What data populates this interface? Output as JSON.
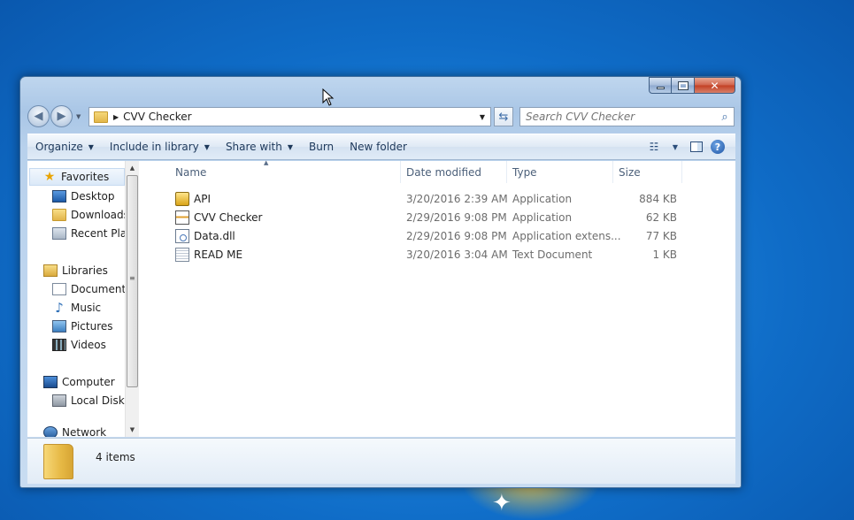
{
  "window": {
    "title": "CVV Checker",
    "controls": {
      "minimize": "minimize",
      "maximize": "maximize",
      "close": "✕"
    }
  },
  "navbar": {
    "address_path": "CVV Checker",
    "search_placeholder": "Search CVV Checker"
  },
  "toolbar": {
    "organize": "Organize",
    "include_in_library": "Include in library",
    "share_with": "Share with",
    "burn": "Burn",
    "new_folder": "New folder"
  },
  "navpane": {
    "favorites": "Favorites",
    "desktop": "Desktop",
    "downloads": "Downloads",
    "recent_places": "Recent Plac",
    "libraries": "Libraries",
    "documents": "Documents",
    "music": "Music",
    "pictures": "Pictures",
    "videos": "Videos",
    "computer": "Computer",
    "local_disk": "Local Disk (",
    "network": "Network"
  },
  "columns": {
    "name": "Name",
    "date_modified": "Date modified",
    "type": "Type",
    "size": "Size"
  },
  "files": [
    {
      "name": "API",
      "date": "3/20/2016 2:39 AM",
      "type": "Application",
      "size": "884 KB",
      "icon": "api-icon"
    },
    {
      "name": "CVV Checker",
      "date": "2/29/2016 9:08 PM",
      "type": "Application",
      "size": "62 KB",
      "icon": "application-icon"
    },
    {
      "name": "Data.dll",
      "date": "2/29/2016 9:08 PM",
      "type": "Application extens...",
      "size": "77 KB",
      "icon": "dll-icon"
    },
    {
      "name": "READ ME",
      "date": "3/20/2016 3:04 AM",
      "type": "Text Document",
      "size": "1 KB",
      "icon": "text-document-icon"
    }
  ],
  "details": {
    "item_count": "4 items"
  },
  "colors": {
    "desktop_blue": "#1a7fd8",
    "window_frame": "#b8d1ec",
    "close_red": "#c23f22",
    "toolbar_text": "#1e395b"
  }
}
